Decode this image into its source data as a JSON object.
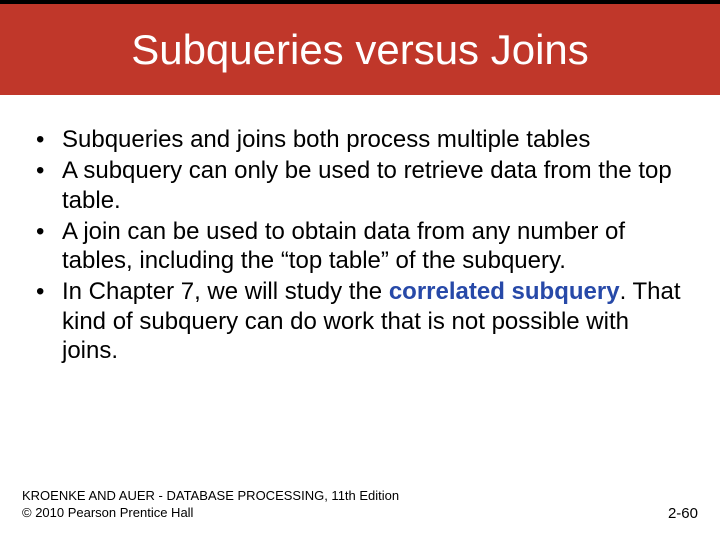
{
  "slide": {
    "title": "Subqueries versus Joins",
    "bullets": [
      {
        "pre": "Subqueries and joins both process multiple tables",
        "bold": "",
        "post": ""
      },
      {
        "pre": "A subquery can only be used to retrieve data from the top table.",
        "bold": "",
        "post": ""
      },
      {
        "pre": "A join can be used to obtain data from any number of tables, including the “top table” of the subquery.",
        "bold": "",
        "post": ""
      },
      {
        "pre": "In Chapter 7, we will study the ",
        "bold": "correlated subquery",
        "post": ".  That kind of subquery can do work that is not possible with joins."
      }
    ],
    "footer_line1": "KROENKE AND AUER - DATABASE PROCESSING, 11th Edition",
    "footer_line2": "© 2010 Pearson Prentice Hall",
    "page_number": "2-60"
  }
}
